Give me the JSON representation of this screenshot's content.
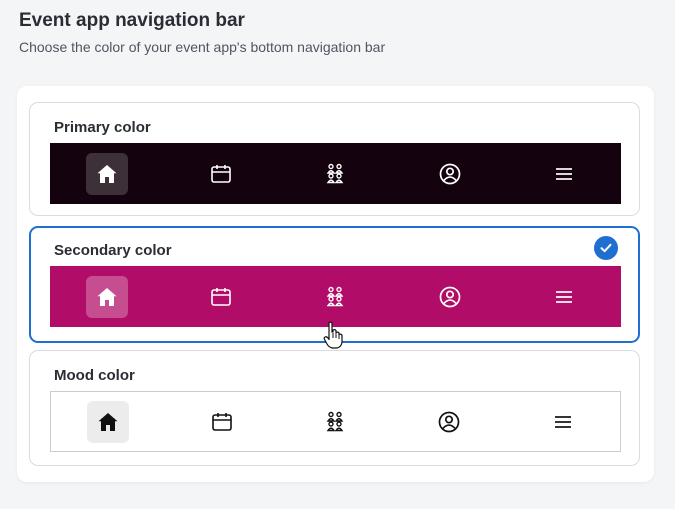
{
  "header": {
    "title": "Event app navigation bar",
    "subtitle": "Choose the color of your event app's bottom navigation bar"
  },
  "options": [
    {
      "label": "Primary color",
      "selected": false,
      "bar_color": "#15020f",
      "icon_color": "#ffffff",
      "active_bg": "#3e3039"
    },
    {
      "label": "Secondary color",
      "selected": true,
      "bar_color": "#b00c68",
      "icon_color": "#ffffff",
      "active_bg": "#c74d91"
    },
    {
      "label": "Mood color",
      "selected": false,
      "bar_color": "#ffffff",
      "icon_color": "#111111",
      "active_bg": "#ececec"
    }
  ],
  "nav_icons": [
    "home-icon",
    "calendar-icon",
    "attendees-icon",
    "profile-icon",
    "menu-icon"
  ],
  "accent_color": "#1f6fd1"
}
